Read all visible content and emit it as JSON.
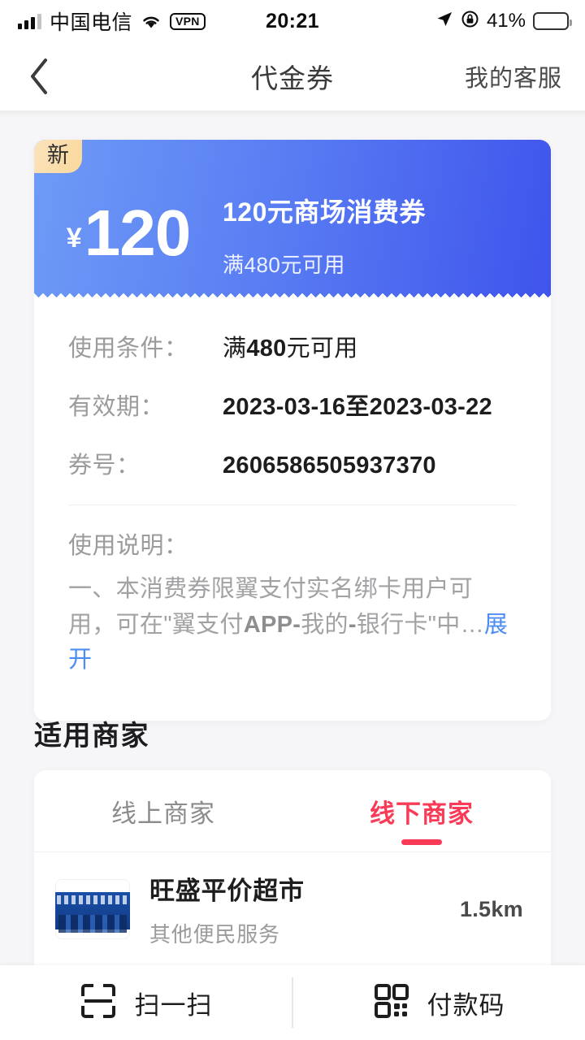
{
  "statusbar": {
    "carrier": "中国电信",
    "vpn": "VPN",
    "time": "20:21",
    "battery_pct": "41%",
    "battery_level": 41
  },
  "header": {
    "title": "代金券",
    "right_action": "我的客服"
  },
  "coupon": {
    "badge": "新",
    "currency": "¥",
    "amount": "120",
    "title": "120元商场消费券",
    "subtitle": "满480元可用",
    "details": [
      {
        "label": "使用条件：",
        "value": "满480元可用",
        "bold_part": "480",
        "style": "mixed"
      },
      {
        "label": "有效期：",
        "value": "2023-03-16至2023-03-22",
        "style": "bold"
      },
      {
        "label": "券号：",
        "value": "2606586505937370",
        "style": "bold"
      }
    ],
    "usage_title": "使用说明：",
    "usage_text": "一、本消费券限翼支付实名绑卡用户可用，可在\"翼支付APP-我的-银行卡\"中…",
    "expand_label": "展开"
  },
  "merchants": {
    "section_title": "适用商家",
    "tabs": [
      {
        "label": "线上商家",
        "active": false
      },
      {
        "label": "线下商家",
        "active": true
      }
    ],
    "list": [
      {
        "name": "旺盛平价超市",
        "category": "其他便民服务",
        "distance": "1.5km"
      }
    ]
  },
  "bottombar": {
    "items": [
      {
        "label": "扫一扫",
        "icon": "scan-icon"
      },
      {
        "label": "付款码",
        "icon": "qrcode-icon"
      }
    ]
  },
  "colors": {
    "coupon_gradient_start": "#6e9bf6",
    "coupon_gradient_end": "#3f54ec",
    "badge_gradient_start": "#fae3bd",
    "badge_gradient_end": "#fbd89b",
    "tab_active": "#fa3b57",
    "link": "#4c8cf5",
    "page_bg": "#f6f6f8"
  }
}
